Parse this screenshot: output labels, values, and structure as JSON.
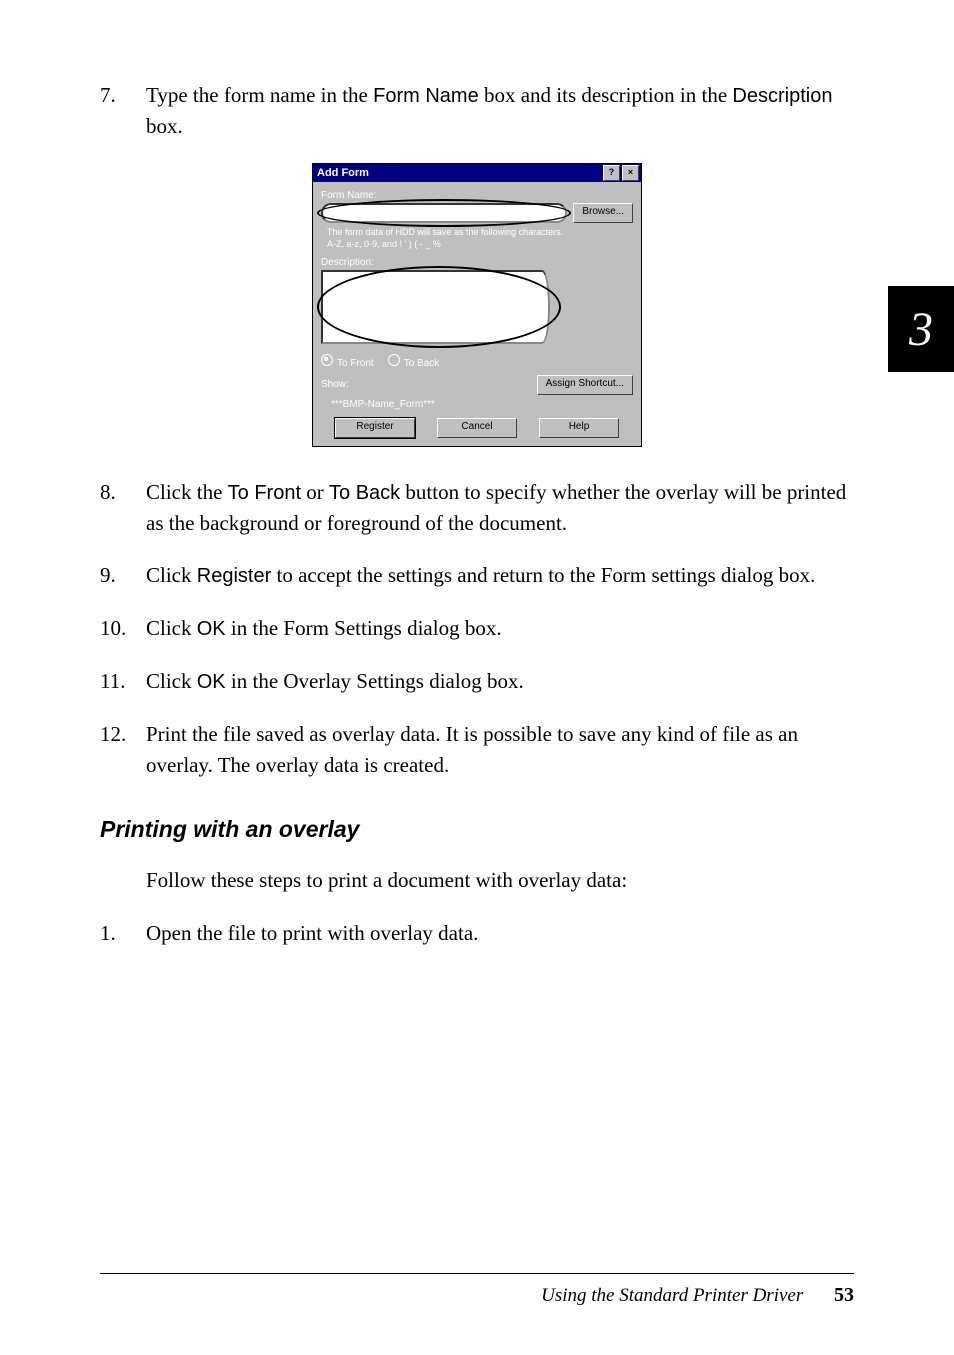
{
  "steps": {
    "s7_num": "7.",
    "s7_a": "Type the form name in the ",
    "s7_b": "Form Name",
    "s7_c": " box and its description in the ",
    "s7_d": "Description",
    "s7_e": " box.",
    "s8_num": "8.",
    "s8_a": "Click the ",
    "s8_b": "To Front",
    "s8_c": " or ",
    "s8_d": "To Back",
    "s8_e": " button to specify whether the overlay will be printed as the background or foreground of the document.",
    "s9_num": "9.",
    "s9_a": "Click ",
    "s9_b": "Register",
    "s9_c": " to accept the settings and return to the Form settings dialog box.",
    "s10_num": "10.",
    "s10_a": "Click ",
    "s10_b": "OK",
    "s10_c": " in the Form Settings dialog box.",
    "s11_num": "11.",
    "s11_a": "Click ",
    "s11_b": "OK",
    "s11_c": " in the Overlay Settings dialog box.",
    "s12_num": "12.",
    "s12_a": "Print the file saved as overlay data. It is possible to save any kind of file as an overlay. The overlay data is created."
  },
  "section_heading": "Printing with an overlay",
  "intro": "Follow these steps to print a document with overlay data:",
  "step1_num": "1.",
  "step1_text": "Open the file to print with overlay data.",
  "footer": {
    "title": "Using the Standard Printer Driver",
    "page": "53"
  },
  "chapter_tab": "3",
  "dialog": {
    "title": "Add Form",
    "help_btn": "?",
    "close_btn": "×",
    "form_name_label": "Form Name:",
    "browse_btn": "Browse...",
    "hint_line1": "The form data of HDD will save as the following characters.",
    "hint_line2": "A-Z, a-z, 0-9, and ! ' ) ( - _ %",
    "description_label": "Description:",
    "radio_front": "To Front",
    "radio_back": "To Back",
    "show_label": "Show:",
    "assign_btn": "Assign Shortcut...",
    "icon_text": "***BMP-Name_Form***",
    "register_btn": "Register",
    "cancel_btn": "Cancel",
    "help_big_btn": "Help"
  }
}
